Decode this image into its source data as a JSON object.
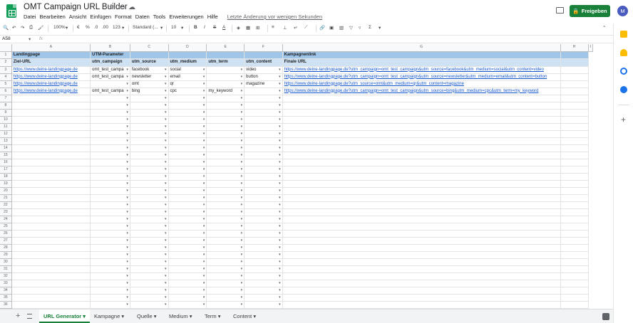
{
  "title": "OMT Campaign URL Builder",
  "menu": [
    "Datei",
    "Bearbeiten",
    "Ansicht",
    "Einfügen",
    "Format",
    "Daten",
    "Tools",
    "Erweiterungen",
    "Hilfe"
  ],
  "last_edit": "Letzte Änderung vor wenigen Sekunden",
  "share_label": "Freigeben",
  "avatar_letter": "M",
  "toolbar": {
    "zoom": "100%",
    "currency": "€",
    "percent": "%",
    "dec0": ".0",
    "dec00": ".00",
    "format_more": "123",
    "font": "Standard (...",
    "size": "10",
    "bold": "B",
    "italic": "I",
    "strike": "S",
    "textcolor": "A"
  },
  "formula_bar": {
    "cell_ref": "A58",
    "fx": "fx",
    "value": ""
  },
  "columns": [
    "A",
    "B",
    "C",
    "D",
    "E",
    "F",
    "G",
    "H",
    "I"
  ],
  "row1": {
    "landingpage": "Landingpage",
    "utm": "UTM-Parameter",
    "kampagnenlink": "Kampagnenlink"
  },
  "row2": [
    "Ziel-URL",
    "utm_campaign",
    "utm_source",
    "utm_medium",
    "utm_term",
    "utm_content",
    "Finale URL"
  ],
  "data_rows": [
    [
      "https://www.deine-landingpage.de",
      "omt_test_campa",
      "facebook",
      "social",
      "",
      "video",
      "https://www.deine-landingpage.de?utm_campaign=omt_test_campaign&utm_source=facebook&utm_medium=social&utm_content=video"
    ],
    [
      "https://www.deine-landingpage.de",
      "omt_test_campa",
      "newsletter",
      "email",
      "",
      "button",
      "https://www.deine-landingpage.de?utm_campaign=omt_test_campaign&utm_source=newsletter&utm_medium=email&utm_content=button"
    ],
    [
      "https://www.deine-landingpage.de",
      "",
      "omt",
      "qr",
      "",
      "magazine",
      "https://www.deine-landingpage.de?utm_source=omt&utm_medium=qr&utm_content=magazine"
    ],
    [
      "https://www.deine-landingpage.de",
      "omt_test_campa",
      "bing",
      "cpc",
      "my_keyword",
      "",
      "https://www.deine-landingpage.de?utm_campaign=omt_test_campaign&utm_source=bing&utm_medium=cpc&utm_term=my_keyword"
    ]
  ],
  "row_numbers": [
    "1",
    "2",
    "3",
    "4",
    "5",
    "6",
    "7",
    "8",
    "9",
    "10",
    "11",
    "12",
    "13",
    "14",
    "15",
    "16",
    "17",
    "18",
    "19",
    "20",
    "21",
    "22",
    "23",
    "24",
    "25",
    "26",
    "27",
    "28",
    "29",
    "30",
    "31",
    "32",
    "33",
    "34",
    "35",
    "36",
    "37"
  ],
  "sheets": [
    "URL Generator",
    "Kampagne",
    "Quelle",
    "Medium",
    "Term",
    "Content"
  ],
  "colors": {
    "header_dark": "#9fc5e8",
    "header_light": "#cfe2f3",
    "share": "#188038",
    "link": "#1155cc"
  }
}
